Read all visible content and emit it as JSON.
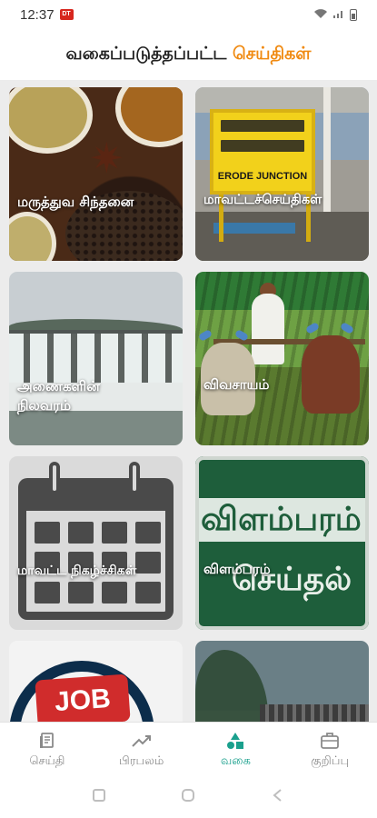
{
  "status_bar": {
    "time": "12:37",
    "app_badge": "DT"
  },
  "header": {
    "title_part1": "வகைப்படுத்தப்பட்ட ",
    "title_part2": "செய்திகள்"
  },
  "colors": {
    "accent_orange": "#f08a11",
    "active_teal": "#1aa08d",
    "inactive_gray": "#8a8a8a"
  },
  "categories": [
    {
      "label": "மருத்துவ சிந்தனை",
      "image": "spices"
    },
    {
      "label": "மாவட்டச்செய்திகள்",
      "image": "erode-junction-sign",
      "sign_text": "ERODE JUNCTION"
    },
    {
      "label": "அணைகளின் நிலவரம்",
      "image": "dam"
    },
    {
      "label": "விவசாயம்",
      "image": "farmer-with-oxen"
    },
    {
      "label": "மாவட்ட நிகழ்ச்சிகள்",
      "image": "calendar"
    },
    {
      "label": "விளம்பரம்",
      "image": "advertisement-board",
      "board_line1": "விளம்பரம்",
      "board_line2": "செய்தல்"
    },
    {
      "label": "",
      "image": "job",
      "badge_text": "JOB"
    },
    {
      "label": "",
      "image": "weather"
    }
  ],
  "bottom_nav": {
    "items": [
      {
        "label": "செய்தி",
        "icon": "news-icon",
        "active": false
      },
      {
        "label": "பிரபலம்",
        "icon": "trending-icon",
        "active": false
      },
      {
        "label": "வகை",
        "icon": "category-icon",
        "active": true
      },
      {
        "label": "குறிப்பு",
        "icon": "briefcase-icon",
        "active": false
      }
    ]
  }
}
